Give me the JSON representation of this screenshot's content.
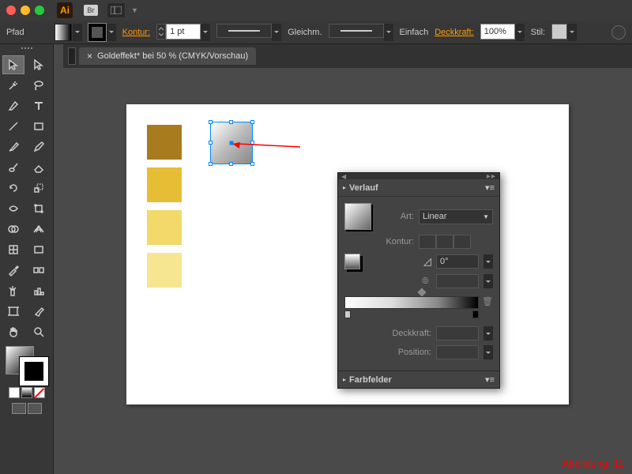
{
  "app": {
    "logo": "Ai",
    "br": "Br"
  },
  "ctrl": {
    "pfad": "Pfad",
    "kontur": "Kontur:",
    "stroke_weight": "1 pt",
    "gleichm": "Gleichm.",
    "einfach": "Einfach",
    "deckkraft": "Deckkraft:",
    "opacity_value": "100%",
    "stil": "Stil:"
  },
  "tab": {
    "title": "Goldeffekt* bei 50 % (CMYK/Vorschau)",
    "close": "×"
  },
  "gradient_panel": {
    "header": "Verlauf",
    "art_label": "Art:",
    "art_value": "Linear",
    "kontur_label": "Kontur:",
    "angle_value": "0°",
    "deckkraft_label": "Deckkraft:",
    "position_label": "Position:",
    "farbfelder": "Farbfelder"
  },
  "swatches": {
    "colors": [
      "#a87b1f",
      "#e5be35",
      "#f2d96a",
      "#f6e691"
    ]
  },
  "figure": "Abbildung: 11"
}
